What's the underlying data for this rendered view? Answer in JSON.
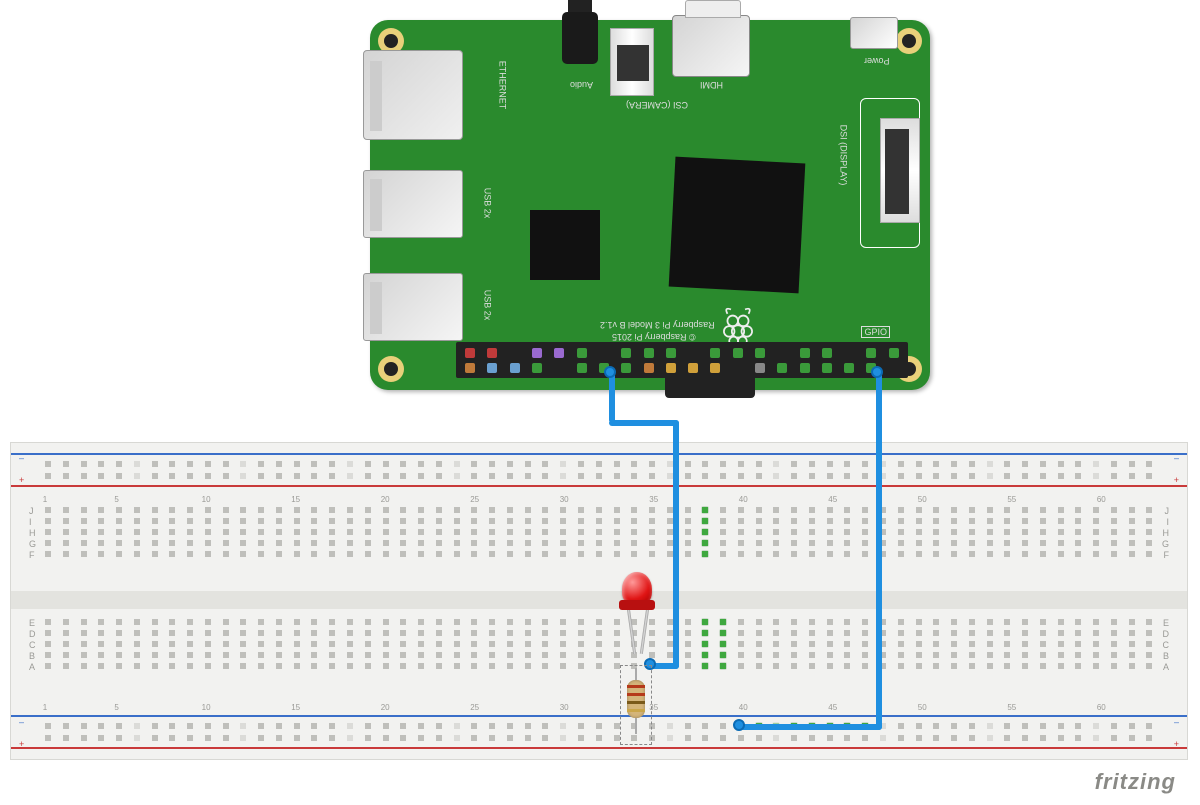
{
  "diagram": {
    "board_label": "Raspberry Pi 3 Model B v1.2",
    "copyright": "© Raspberry Pi 2015",
    "labels": {
      "ethernet": "ETHERNET",
      "usb": "USB 2x",
      "audio": "Audio",
      "csi": "CSI (CAMERA)",
      "hdmi": "HDMI",
      "power": "Power",
      "dsi": "DSI (DISPLAY)",
      "gpio": "GPIO"
    },
    "gpio_pins_top": [
      "5V",
      "5V",
      "GND",
      "UART",
      "UART",
      "GPIO",
      "GND",
      "GPIO",
      "GPIO",
      "GPIO",
      "GND",
      "GPIO",
      "GPIO",
      "GPIO",
      "GND",
      "GPIO",
      "GPIO",
      "GND",
      "GPIO",
      "GPIO"
    ],
    "gpio_pins_bottom": [
      "3V3",
      "I2C",
      "I2C",
      "GPIO",
      "GND",
      "GPIO",
      "GPIO",
      "GPIO",
      "3V3",
      "SPI",
      "SPI",
      "SPI",
      "GND",
      "ID",
      "GPIO",
      "GPIO",
      "GPIO",
      "GPIO",
      "GPIO",
      "GND"
    ],
    "pin_colors": {
      "5V": "#c03a3a",
      "3V3": "#c07a3a",
      "GND": "#222",
      "GPIO": "#3a9a3a",
      "I2C": "#6aa0d0",
      "UART": "#9a6ad0",
      "SPI": "#d0a03a",
      "ID": "#888"
    }
  },
  "breadboard": {
    "cols": 63,
    "top_rows": [
      "J",
      "I",
      "H",
      "G",
      "F"
    ],
    "bottom_rows": [
      "E",
      "D",
      "C",
      "B",
      "A"
    ],
    "rail_signs": {
      "plus": "+",
      "minus": "–"
    },
    "green_cells": {
      "top": {
        "F": [
          38
        ],
        "G": [
          38
        ],
        "H": [
          38
        ],
        "I": [
          38
        ],
        "J": [
          38
        ]
      },
      "bottom": {
        "A": [
          38,
          39
        ],
        "B": [
          38,
          39
        ],
        "C": [
          38,
          39
        ],
        "D": [
          38,
          39
        ],
        "E": [
          38,
          39
        ]
      }
    },
    "col_numbers": [
      1,
      5,
      10,
      15,
      20,
      25,
      30,
      35,
      40,
      45,
      50,
      55,
      60
    ]
  },
  "components": {
    "led": {
      "color": "red",
      "anode_col": 38,
      "cathode_col": 39
    },
    "resistor": {
      "value_ohm": 220,
      "bands": [
        "#b53a1a",
        "#b53a1a",
        "#7a5a1a",
        "#caa64a"
      ],
      "from": "bb.A38",
      "to": "bb.ground_rail"
    },
    "wires": [
      {
        "color": "#1f8fe0",
        "from": "pi.gpio_pin_top_row_7",
        "to": "bb.B39",
        "purpose": "GPIO signal"
      },
      {
        "color": "#1f8fe0",
        "from": "pi.gpio_pin_top_row_20",
        "to": "bb.bottom_ground_rail",
        "purpose": "GND"
      }
    ]
  },
  "watermark": "fritzing"
}
